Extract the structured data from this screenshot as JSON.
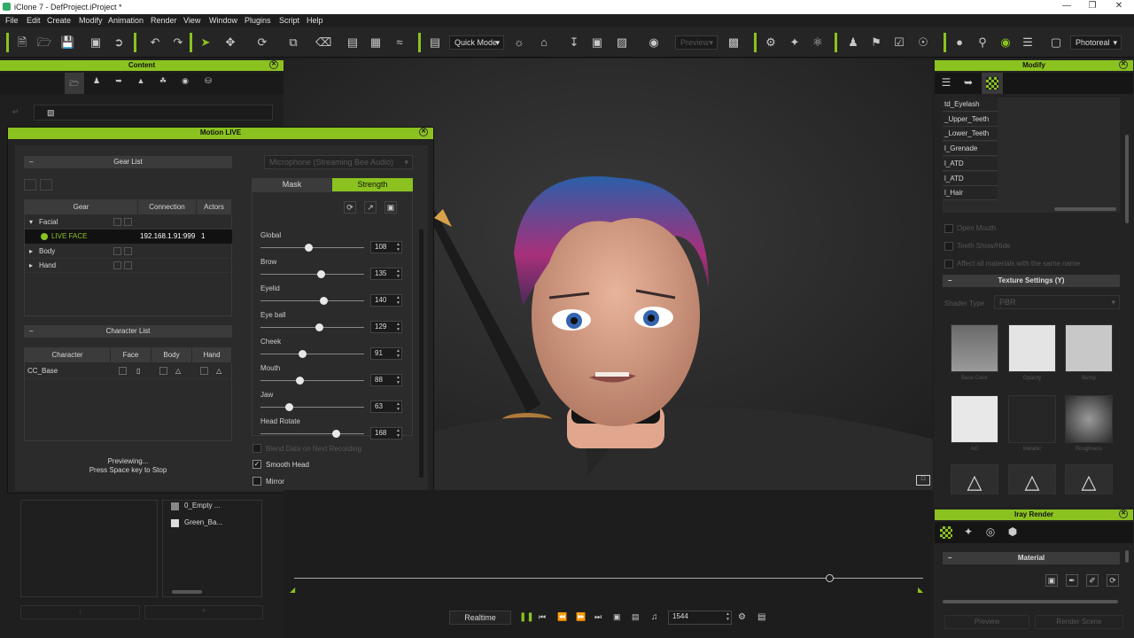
{
  "window": {
    "title": "iClone 7 - DefProject.iProject *"
  },
  "menu": [
    "File",
    "Edit",
    "Create",
    "Modify",
    "Animation",
    "Render",
    "View",
    "Window",
    "Plugins",
    "Script",
    "Help"
  ],
  "toolbar": {
    "mode_label": "Quick Mode",
    "preview_label": "Preview",
    "render_label": "Photoreal"
  },
  "content": {
    "title": "Content"
  },
  "motion_live": {
    "title": "Motion LIVE",
    "gear_list": "Gear List",
    "gear_headers": [
      "Gear",
      "Connection",
      "Actors"
    ],
    "gears": [
      {
        "name": "Facial",
        "connection": "",
        "actors": ""
      },
      {
        "name": "LIVE FACE",
        "connection": "192.168.1.91:999",
        "actors": "1"
      },
      {
        "name": "Body",
        "connection": "",
        "actors": ""
      },
      {
        "name": "Hand",
        "connection": "",
        "actors": ""
      }
    ],
    "character_list": "Character List",
    "char_headers": [
      "Character",
      "Face",
      "Body",
      "Hand"
    ],
    "character": "CC_Base",
    "status": "Previewing...",
    "status2": "Press Space key to Stop",
    "audio_device": "Microphone (Streaming Bee Audio)",
    "tab_mask": "Mask",
    "tab_strength": "Strength",
    "sliders": [
      {
        "label": "Global",
        "value": "108",
        "pct": 0.46
      },
      {
        "label": "Brow",
        "value": "135",
        "pct": 0.58
      },
      {
        "label": "Eyelid",
        "value": "140",
        "pct": 0.61
      },
      {
        "label": "Eye ball",
        "value": "129",
        "pct": 0.56
      },
      {
        "label": "Cheek",
        "value": "91",
        "pct": 0.4
      },
      {
        "label": "Mouth",
        "value": "88",
        "pct": 0.38
      },
      {
        "label": "Jaw",
        "value": "63",
        "pct": 0.27
      },
      {
        "label": "Head Rotate",
        "value": "168",
        "pct": 0.73
      }
    ],
    "blend_label": "Blend Data on Next Recording",
    "smooth_label": "Smooth Head",
    "mirror_label": "Mirror"
  },
  "content_bottom": {
    "items": [
      "0_Empty ...",
      "Green_Ba..."
    ]
  },
  "modify": {
    "title": "Modify",
    "materials": [
      "td_Eyelash",
      "_Upper_Teeth",
      "_Lower_Teeth",
      "l_Grenade",
      "l_ATD",
      "l_ATD",
      "l_Hair"
    ],
    "open_mouth": "Open Mouth",
    "teeth": "Teeth Show/Hide",
    "affect": "Affect all materials with the same name",
    "texture_settings": "Texture Settings  (Y)",
    "shader_type": "Shader Type",
    "shader_value": "PBR",
    "textures": [
      "Base Color",
      "Opacity",
      "Bump",
      "AO",
      "Metallic",
      "Roughness"
    ]
  },
  "iray": {
    "title": "Iray Render",
    "material": "Material",
    "preview": "Preview",
    "render_scene": "Render Scene"
  },
  "timeline": {
    "realtime": "Realtime",
    "frame": "1544"
  },
  "colors": {
    "accent": "#8bc220"
  }
}
